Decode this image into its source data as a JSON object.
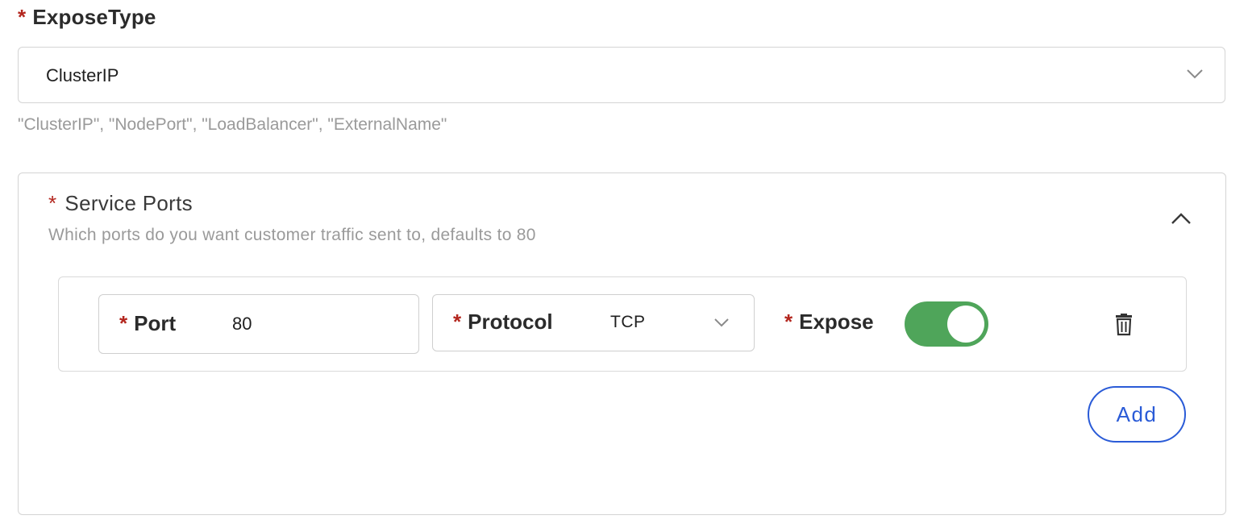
{
  "expose_type": {
    "required_marker": "*",
    "label": "ExposeType",
    "selected_value": "ClusterIP",
    "helper_text": "\"ClusterIP\", \"NodePort\", \"LoadBalancer\", \"ExternalName\""
  },
  "service_ports": {
    "required_marker": "*",
    "title": "Service Ports",
    "description": "Which ports do you want customer traffic sent to, defaults to 80",
    "collapse_icon": "chevron-up-icon",
    "rows": [
      {
        "port": {
          "required_marker": "*",
          "label": "Port",
          "value": "80"
        },
        "protocol": {
          "required_marker": "*",
          "label": "Protocol",
          "value": "TCP"
        },
        "expose": {
          "required_marker": "*",
          "label": "Expose",
          "enabled": true,
          "toggle_color": "#4fa55a"
        },
        "delete_icon": "trash-icon"
      }
    ],
    "add_label": "Add",
    "accent_color": "#2a5bd7"
  }
}
